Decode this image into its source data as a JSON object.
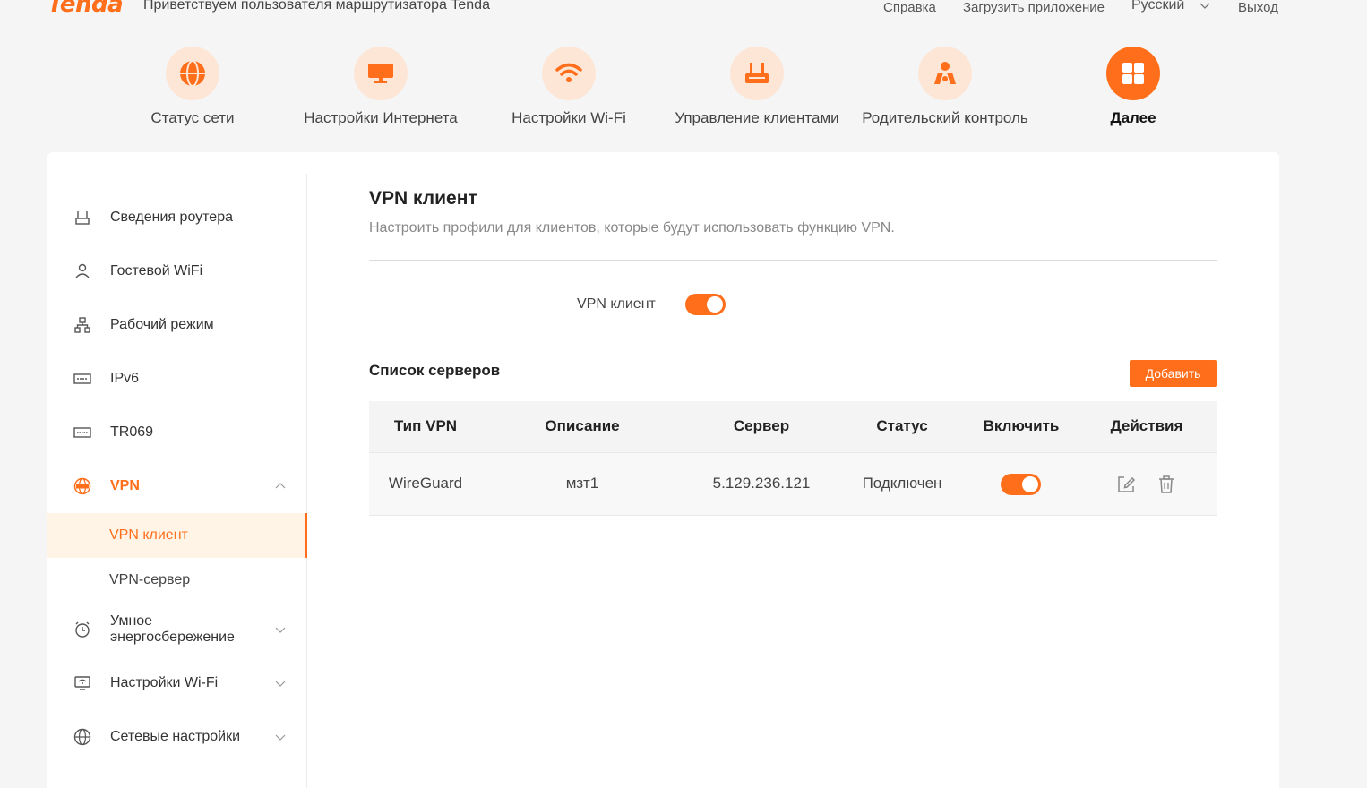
{
  "header": {
    "logo": "Tenda",
    "welcome": "Приветствуем пользователя маршрутизатора Tenda",
    "help": "Справка",
    "download_app": "Загрузить приложение",
    "language": "Русский",
    "logout": "Выход"
  },
  "topnav": [
    {
      "label": "Статус сети",
      "icon": "globe-icon"
    },
    {
      "label": "Настройки Интернета",
      "icon": "monitor-icon"
    },
    {
      "label": "Настройки Wi-Fi",
      "icon": "wifi-icon"
    },
    {
      "label": "Управление клиентами",
      "icon": "router-icon"
    },
    {
      "label": "Родительский контроль",
      "icon": "family-icon"
    },
    {
      "label": "Далее",
      "icon": "grid-icon",
      "active": true
    }
  ],
  "sidebar": {
    "items": [
      {
        "label": "Сведения роутера",
        "icon": "router-info-icon"
      },
      {
        "label": "Гостевой WiFi",
        "icon": "guest-icon"
      },
      {
        "label": "Рабочий режим",
        "icon": "topology-icon"
      },
      {
        "label": "IPv6",
        "icon": "ipv6-icon"
      },
      {
        "label": "TR069",
        "icon": "tr069-icon"
      },
      {
        "label": "VPN",
        "icon": "vpn-icon",
        "expanded": true
      },
      {
        "label": "Умное энергосбережение",
        "icon": "energy-icon"
      },
      {
        "label": "Настройки Wi-Fi",
        "icon": "wifi-settings-icon"
      },
      {
        "label": "Сетевые настройки",
        "icon": "network-icon"
      }
    ],
    "vpn_sub": [
      {
        "label": "VPN клиент",
        "active": true
      },
      {
        "label": "VPN-сервер"
      }
    ]
  },
  "main": {
    "title": "VPN клиент",
    "subtitle": "Настроить профили для клиентов, которые будут использовать функцию VPN.",
    "vpn_client_label": "VPN клиент",
    "vpn_client_enabled": true,
    "server_list_title": "Список серверов",
    "add_button": "Добавить",
    "table": {
      "headers": [
        "Тип VPN",
        "Описание",
        "Сервер",
        "Статус",
        "Включить",
        "Действия"
      ],
      "rows": [
        {
          "type": "WireGuard",
          "description": "мзт1",
          "server": "5.129.236.121",
          "status": "Подключен",
          "enabled": true
        }
      ]
    }
  },
  "colors": {
    "accent": "#ff6e1b",
    "accent_light": "#fde6d6"
  }
}
